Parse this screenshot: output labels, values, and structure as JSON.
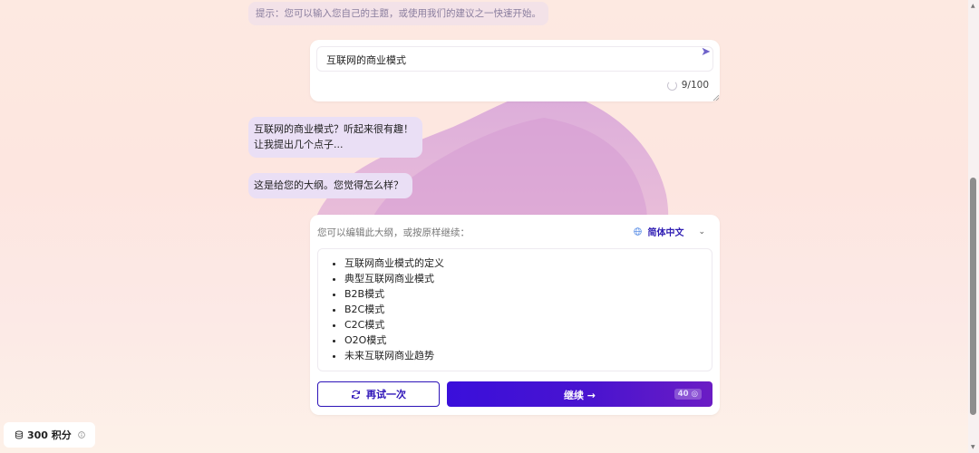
{
  "hint": "提示：您可以输入您自己的主题，或使用我们的建议之一快速开始。",
  "input": {
    "value": "互联网的商业模式",
    "counter": "9/100",
    "send_icon": "send-icon"
  },
  "chat": {
    "reply_line1": "互联网的商业模式？听起来很有趣！",
    "reply_line2": "让我提出几个点子...",
    "outline_question": "这是给您的大纲。您觉得怎么样？"
  },
  "outline": {
    "prompt": "您可以编辑此大纲，或按原样继续：",
    "language": "简体中文",
    "items": [
      "互联网商业模式的定义",
      "典型互联网商业模式",
      "B2B模式",
      "B2C模式",
      "C2C模式",
      "O2O模式",
      "未来互联网商业趋势"
    ]
  },
  "actions": {
    "retry_label": "再试一次",
    "continue_label": "继续 →",
    "continue_cost": "40"
  },
  "credits": {
    "label": "300 积分"
  },
  "colors": {
    "accent": "#2d13b8",
    "bubble": "#eadff5",
    "gradient_start": "#3a0fdb",
    "gradient_end": "#6b1cc4"
  }
}
